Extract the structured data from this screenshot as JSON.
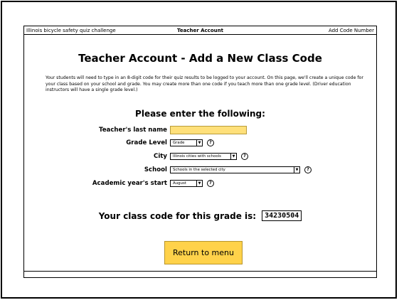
{
  "titlebar": {
    "left": "Illinois bicycle safety quiz challenge",
    "center": "Teacher Account",
    "right": "Add Code Number"
  },
  "heading": "Teacher Account - Add a New Class Code",
  "intro": "Your students will need to type in an 8-digit code for their quiz results to be logged to your account.  On this page, we'll create a unique code for your class based on your school and grade.  You may create more than one code if you teach more than one grade level.  (Driver education instructors will have a single grade level.)",
  "subheading": "Please enter the following:",
  "form": {
    "last_name_label": "Teacher's last name",
    "last_name_value": "",
    "grade_label": "Grade Level",
    "grade_value": "Grade",
    "city_label": "City",
    "city_value": "Illinois cities with schools",
    "school_label": "School",
    "school_value": "Schools in the selected city",
    "year_label": "Academic year's start",
    "year_value": "August"
  },
  "code": {
    "label": "Your class code for this grade is:",
    "value": "34230504"
  },
  "return_button": "Return to menu",
  "icons": {
    "help": "help-icon",
    "dropdown": "chevron-down-icon"
  }
}
